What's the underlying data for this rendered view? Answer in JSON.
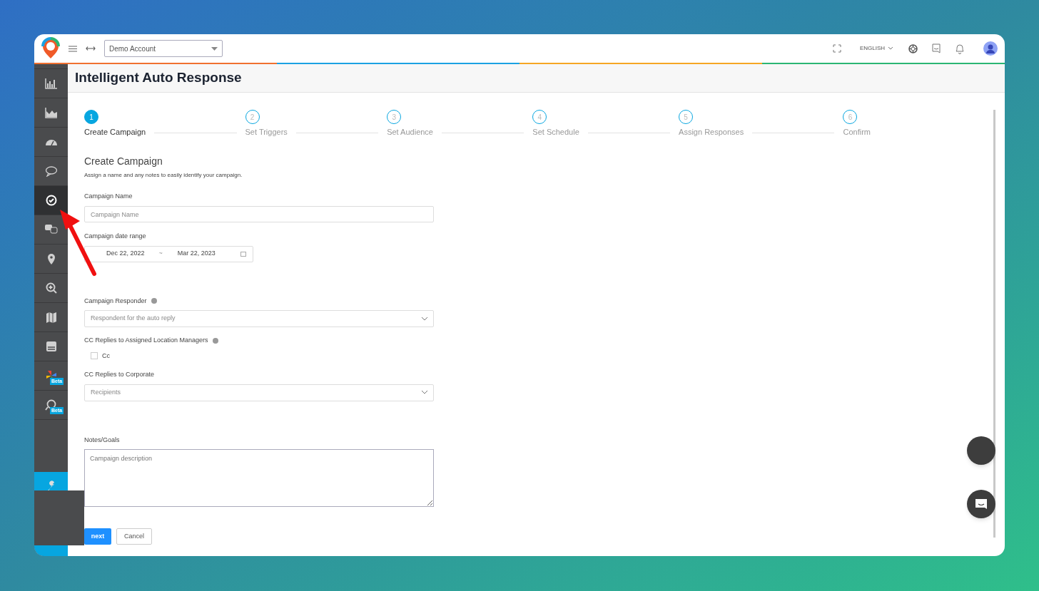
{
  "topbar": {
    "account": "Demo Account",
    "language": "ENGLISH"
  },
  "sidebar": {
    "items": [
      {
        "selected": false
      },
      {
        "selected": false
      },
      {
        "selected": false
      },
      {
        "selected": false
      },
      {
        "selected": true
      },
      {
        "selected": false
      },
      {
        "selected": false
      },
      {
        "selected": false
      },
      {
        "selected": false
      },
      {
        "selected": false
      },
      {
        "selected": false,
        "badge": "Beta"
      },
      {
        "selected": false,
        "badge": "Beta"
      }
    ]
  },
  "page_title": "Intelligent Auto Response",
  "steps": [
    {
      "number": "1",
      "label": "Create Campaign",
      "selected": true
    },
    {
      "number": "2",
      "label": "Set Triggers",
      "selected": false
    },
    {
      "number": "3",
      "label": "Set Audience",
      "selected": false
    },
    {
      "number": "4",
      "label": "Set Schedule",
      "selected": false
    },
    {
      "number": "5",
      "label": "Assign Responses",
      "selected": false
    },
    {
      "number": "6",
      "label": "Confirm",
      "selected": false
    }
  ],
  "form": {
    "heading": "Create Campaign",
    "subtitle": "Assign a name and any notes to easily identify your campaign.",
    "name_label": "Campaign Name",
    "name_placeholder": "Campaign Name",
    "date_label": "Campaign date range",
    "date_start": "Dec 22, 2022",
    "date_sep": "~",
    "date_end": "Mar 22, 2023",
    "responder_label": "Campaign Responder",
    "responder_placeholder": "Respondent for the auto reply",
    "cc_label": "CC Replies to Assigned Location Managers",
    "cc_checkbox": {
      "label": "Cc",
      "checked": false
    },
    "corporate_label": "CC Replies to Corporate",
    "corporate_placeholder": "Recipients",
    "notes_label": "Notes/Goals",
    "notes_placeholder": "Campaign description",
    "buttons": [
      {
        "label": "next",
        "kind": "primary"
      },
      {
        "label": "Cancel",
        "kind": "secondary"
      }
    ]
  }
}
